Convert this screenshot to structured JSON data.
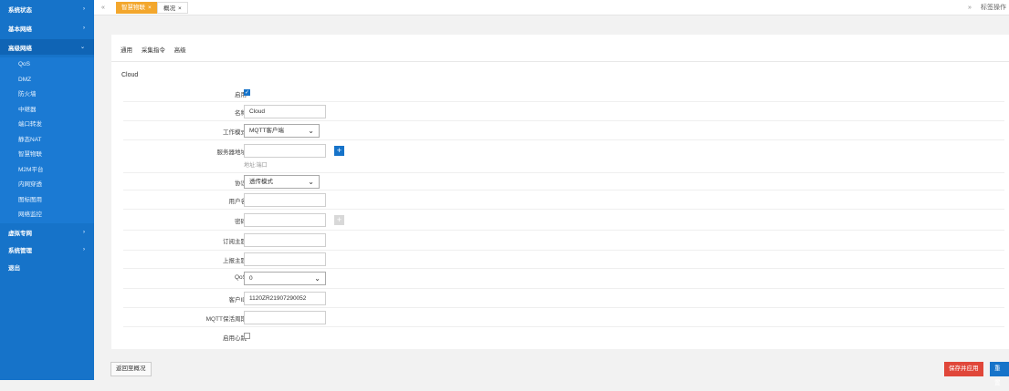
{
  "sidebar": {
    "items": [
      {
        "label": "系统状态"
      },
      {
        "label": "基本网络"
      },
      {
        "label": "高级网络"
      }
    ],
    "sub_items": [
      "QoS",
      "DMZ",
      "防火墙",
      "中继器",
      "端口转发",
      "静态NAT",
      "智慧物联",
      "M2M平台",
      "内网穿透",
      "图标图用",
      "网络监控"
    ],
    "bottom_items": [
      {
        "label": "虚拟专网"
      },
      {
        "label": "系统管理"
      },
      {
        "label": "退出"
      }
    ]
  },
  "topbar": {
    "tabs": [
      {
        "label": "智慧物联"
      },
      {
        "label": "概况"
      }
    ],
    "right_label": "标签操作"
  },
  "subtabs": [
    "通用",
    "采集指令",
    "高级"
  ],
  "section_title": "Cloud",
  "form": {
    "enable_label": "启用",
    "name_label": "名称",
    "name_value": "Cloud",
    "mode_label": "工作模式",
    "mode_value": "MQTT客户端",
    "server_label": "服务器地址",
    "server_hint": "地址:端口",
    "protocol_label": "协议",
    "protocol_value": "透传模式",
    "username_label": "用户名",
    "password_label": "密码",
    "subscribe_label": "订阅主题",
    "publish_label": "上报主题",
    "qos_label": "QoS",
    "qos_value": "0",
    "client_id_label": "客户ID",
    "client_id_value": "1120ZR21907290052",
    "keepalive_label": "MQTT保活周期",
    "heartbeat_label": "启用心跳"
  },
  "footer": {
    "back_label": "返回至概况",
    "save_label": "保存并应用",
    "reset_label": "重置"
  },
  "colors": {
    "sidebar": "#1673c9",
    "accent_tab": "#f3a72d",
    "save": "#e0473a"
  }
}
